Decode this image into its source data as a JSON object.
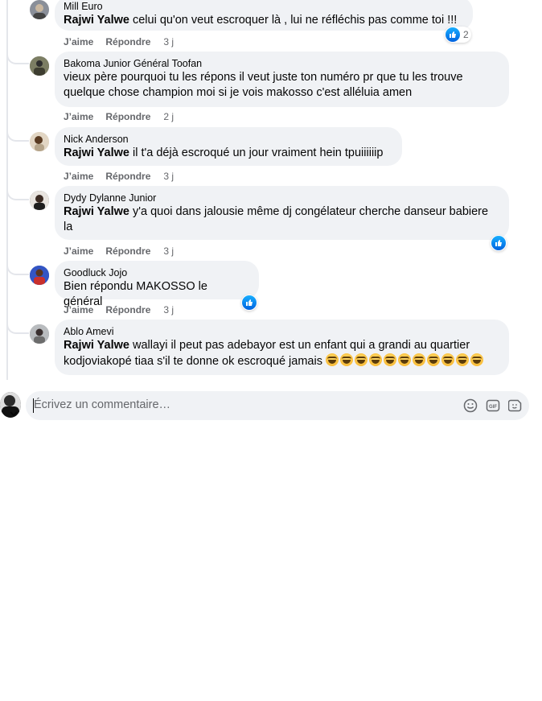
{
  "actions": {
    "like": "J’aime",
    "reply": "Répondre"
  },
  "comments": [
    {
      "author": "Mill Euro",
      "mention": "Rajwi Yalwe",
      "lines": [
        "celui qu'on veut escroquer là , lui ne réfléchis pas comme toi !!!"
      ],
      "time": "3 j",
      "reactions": {
        "icon": "like-icon",
        "count": "2"
      }
    },
    {
      "author": "Bakoma Junior Général Toofan",
      "mention": "",
      "lines": [
        "vieux père pourquoi tu les répons il veut juste ton numéro pr que tu les trouve",
        "quelque chose champion moi si je vois makosso c'est alléluia amen"
      ],
      "time": "2 j"
    },
    {
      "author": "Nick Anderson",
      "mention": "Rajwi Yalwe",
      "lines": [
        "il t'a déjà escroqué un jour vraiment hein tpuiiiiiip"
      ],
      "time": "3 j"
    },
    {
      "author": "Dydy Dylanne Junior",
      "mention": "Rajwi Yalwe",
      "lines": [
        "y'a quoi dans jalousie même dj congélateur cherche danseur babiere",
        "la"
      ],
      "time": "3 j",
      "reactions": {
        "icon": "like-icon",
        "count": ""
      }
    },
    {
      "author": "Goodluck Jojo",
      "mention": "",
      "lines": [
        "Bien répondu MAKOSSO le général"
      ],
      "time": "3 j",
      "reactions": {
        "icon": "like-icon",
        "count": ""
      }
    },
    {
      "author": "Ablo Amevi",
      "mention": "Rajwi Yalwe",
      "lines": [
        "wallayi il peut pas adebayor est un enfant qui a grandi au quartier",
        "kodjoviakopé tiaa s'il te donne ok escroqué jamais"
      ],
      "emoji": "laughing-face-emoji",
      "emoji_count": 11,
      "time": "3 j"
    }
  ],
  "composer": {
    "placeholder": "Écrivez un commentaire…",
    "icons": [
      "emoji-icon",
      "gif-icon",
      "sticker-icon"
    ]
  },
  "colors": {
    "bubble": "#f0f2f5",
    "meta": "#65676b",
    "like": "#0866ff"
  }
}
